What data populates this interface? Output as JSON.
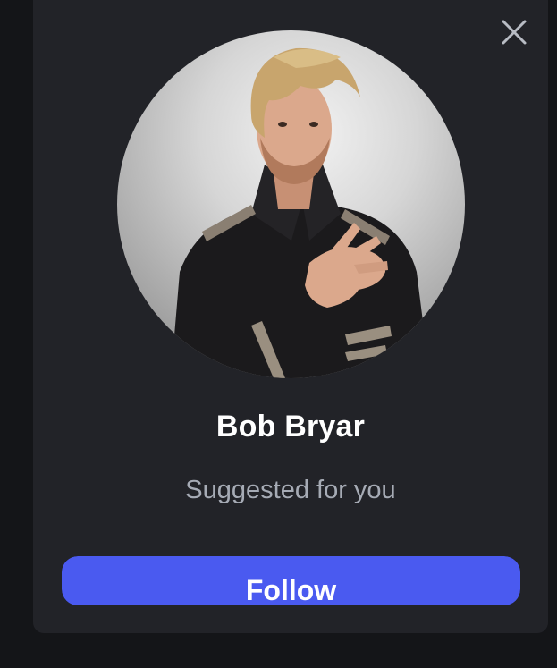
{
  "suggestion_card": {
    "close_icon": "close-icon",
    "avatar_alt": "profile photo",
    "name": "Bob Bryar",
    "subtitle": "Suggested for you",
    "follow_label": "Follow"
  },
  "colors": {
    "page_background": "#141518",
    "card_background": "#222328",
    "name_text": "#ffffff",
    "subtitle_text": "#a6abb5",
    "follow_button": "#4a5af0",
    "close_icon": "#b8bcc4"
  }
}
